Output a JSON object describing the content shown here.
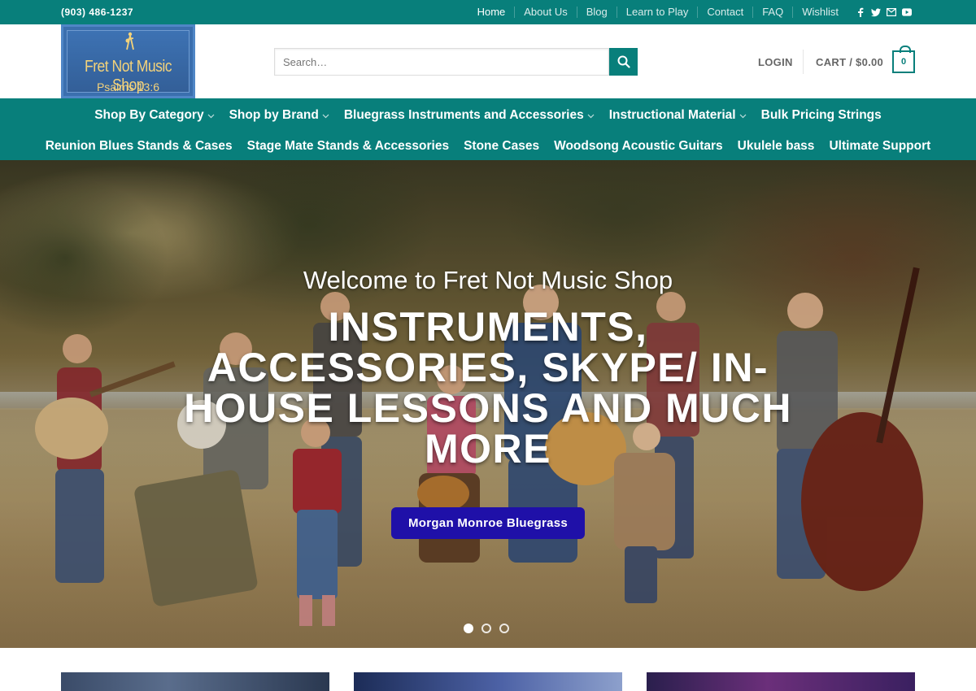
{
  "topbar": {
    "phone": "(903) 486-1237",
    "links": [
      "Home",
      "About Us",
      "Blog",
      "Learn to Play",
      "Contact",
      "FAQ",
      "Wishlist"
    ],
    "social_icons": [
      "facebook-icon",
      "twitter-icon",
      "email-icon",
      "youtube-icon"
    ]
  },
  "header": {
    "logo_title": "Fret Not Music Shop",
    "logo_sub": "Psalms 13:6",
    "search_placeholder": "Search…",
    "login_label": "LOGIN",
    "cart_label": "CART / $0.00",
    "cart_count": "0"
  },
  "nav": {
    "row1": [
      {
        "label": "Shop By Category",
        "dropdown": true
      },
      {
        "label": "Shop by Brand",
        "dropdown": true
      },
      {
        "label": "Bluegrass Instruments and Accessories",
        "dropdown": true
      },
      {
        "label": "Instructional Material",
        "dropdown": true
      },
      {
        "label": "Bulk Pricing Strings",
        "dropdown": false
      }
    ],
    "row2": [
      {
        "label": "Reunion Blues Stands & Cases"
      },
      {
        "label": "Stage Mate Stands & Accessories"
      },
      {
        "label": "Stone Cases"
      },
      {
        "label": "Woodsong Acoustic Guitars"
      },
      {
        "label": "Ukulele bass"
      },
      {
        "label": "Ultimate Support"
      }
    ]
  },
  "hero": {
    "intro": "Welcome to Fret Not Music Shop",
    "headline": "INSTRUMENTS, ACCESSORIES, SKYPE/ IN-HOUSE LESSONS AND MUCH MORE",
    "button_label": "Morgan Monroe Bluegrass",
    "slides": 3,
    "active_slide": 1
  },
  "colors": {
    "brand_teal": "#087f7b",
    "hero_button": "#1f10a8"
  }
}
